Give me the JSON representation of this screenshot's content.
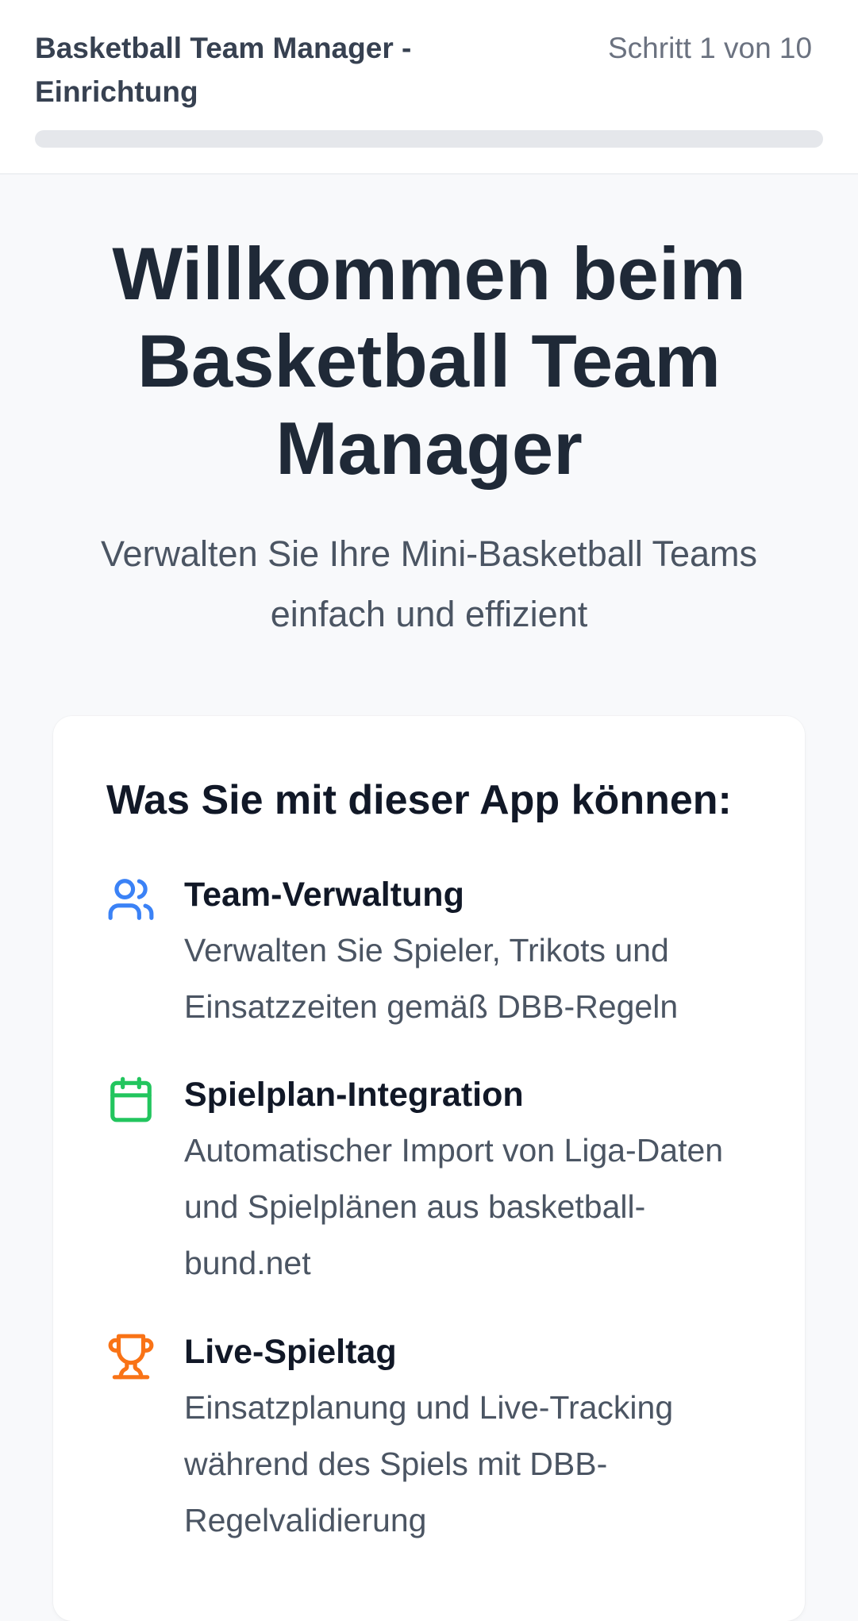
{
  "header": {
    "title": "Basketball Team Manager - Einrichtung",
    "step": "Schritt 1 von 10",
    "progress": 0.0
  },
  "hero": {
    "title": "Willkommen beim Basketball Team Manager",
    "subtitle": "Verwalten Sie Ihre Mini-Basketball Teams einfach und effizient"
  },
  "features_card": {
    "title": "Was Sie mit dieser App können:",
    "items": [
      {
        "icon": "users-icon",
        "color": "#3b82f6",
        "title": "Team-Verwaltung",
        "description": "Verwalten Sie Spieler, Trikots und Einsatzzeiten gemäß DBB-Regeln"
      },
      {
        "icon": "calendar-icon",
        "color": "#22c55e",
        "title": "Spielplan-Integration",
        "description": "Automatischer Import von Liga-Daten und Spielplänen aus basketball-bund.net"
      },
      {
        "icon": "trophy-icon",
        "color": "#f97316",
        "title": "Live-Spieltag",
        "description": "Einsatzplanung und Live-Tracking während des Spiels mit DBB-Regelvalidierung"
      }
    ]
  }
}
